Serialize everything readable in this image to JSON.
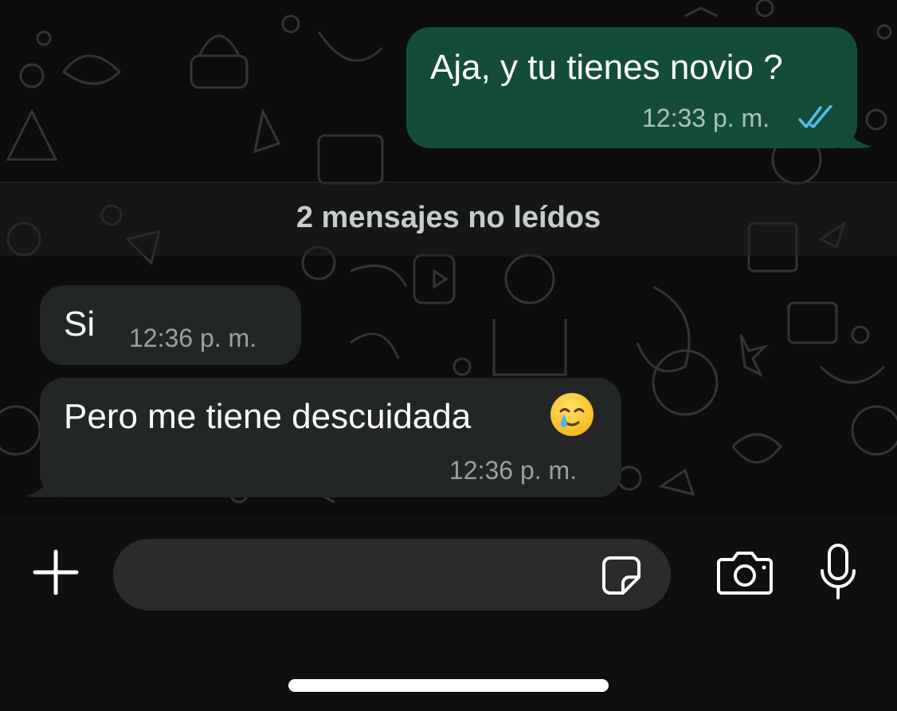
{
  "chat": {
    "messages": [
      {
        "direction": "outgoing",
        "text": "Aja, y tu tienes novio ?",
        "time": "12:33 p. m.",
        "status_icon": "double-check-read-icon"
      },
      {
        "direction": "incoming",
        "text": "Si",
        "time": "12:36 p. m."
      },
      {
        "direction": "incoming",
        "text": "Pero me tiene descuidada",
        "emoji": "smiling-face-with-tear-icon",
        "time": "12:36 p. m."
      }
    ],
    "unread_divider": "2 mensajes no leídos"
  },
  "composer": {
    "plus_icon": "plus-icon",
    "input_value": "",
    "sticker_icon": "sticker-icon",
    "camera_icon": "camera-icon",
    "mic_icon": "microphone-icon"
  },
  "colors": {
    "background": "#0d0d0d",
    "outgoing_bubble": "#144d37",
    "incoming_bubble": "#232626",
    "read_check": "#53bdeb",
    "text": "#ffffff",
    "timestamp": "#9aa0a0"
  }
}
